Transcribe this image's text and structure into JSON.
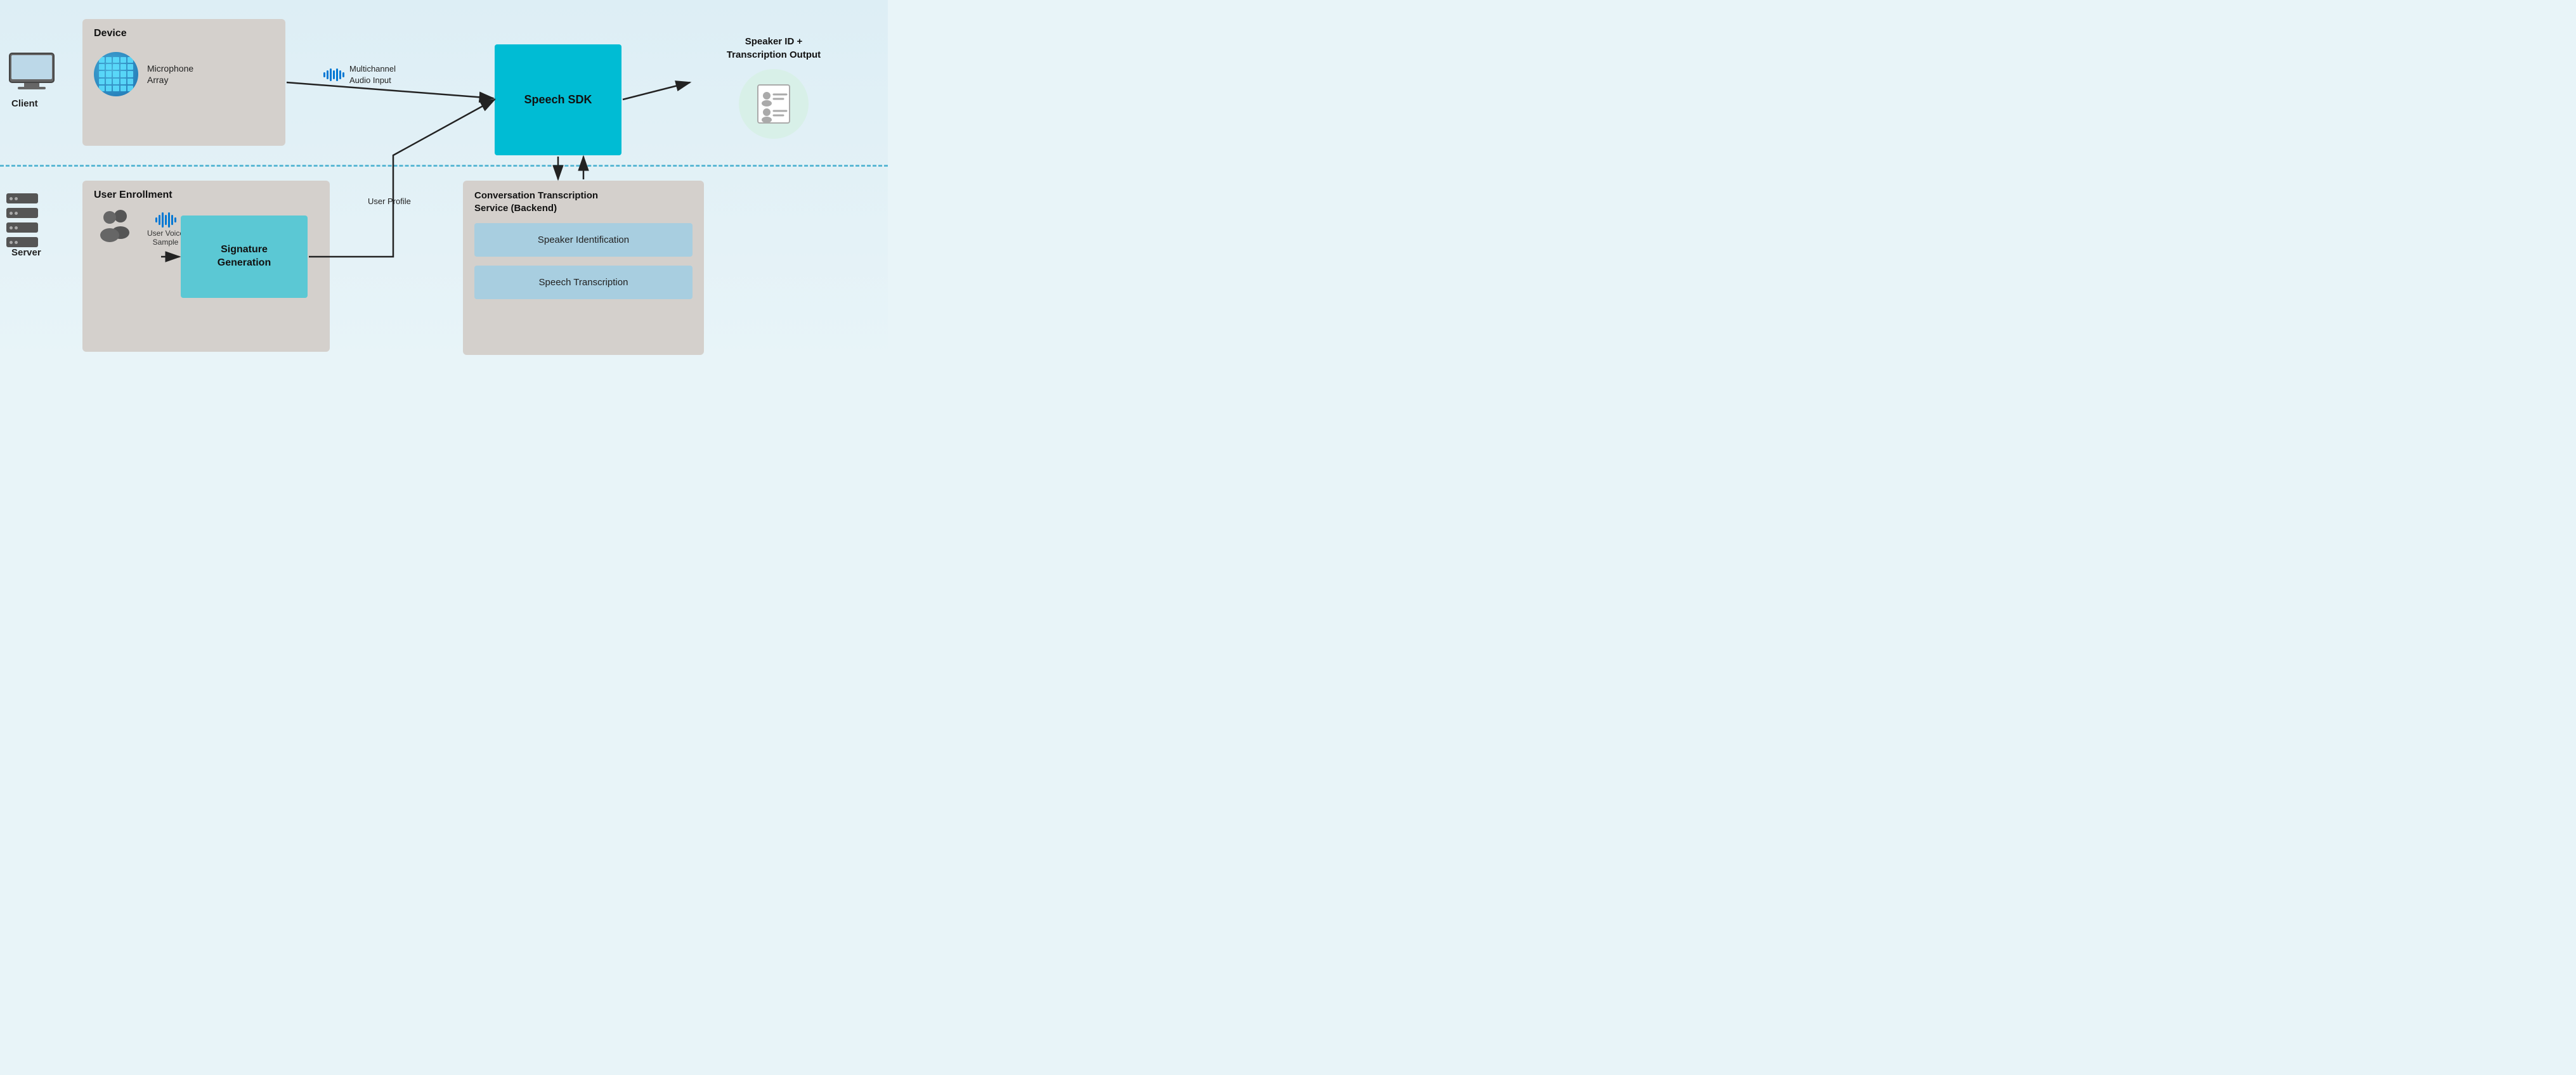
{
  "diagram": {
    "labels": {
      "client": "Client",
      "server": "Server"
    },
    "device_box": {
      "title": "Device",
      "mic_label": "Microphone\nArray"
    },
    "audio_input": {
      "label": "Multichannel\nAudio Input"
    },
    "speech_sdk": {
      "label": "Speech SDK"
    },
    "output": {
      "title": "Speaker ID +\nTranscription Output"
    },
    "enrollment_box": {
      "title": "User Enrollment"
    },
    "voice_sample": {
      "label": "User Voice\nSample"
    },
    "sig_gen": {
      "label": "Signature\nGeneration"
    },
    "user_profile": {
      "label": "User Profile"
    },
    "cts_box": {
      "title": "Conversation Transcription\nService (Backend)"
    },
    "speaker_id": {
      "label": "Speaker Identification"
    },
    "speech_transcription": {
      "label": "Speech Transcription"
    }
  }
}
